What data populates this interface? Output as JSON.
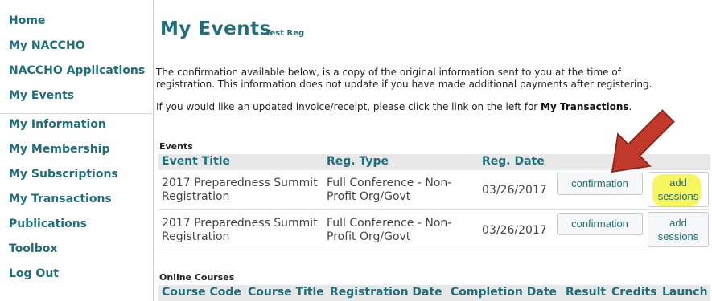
{
  "sidebar": {
    "items": [
      {
        "label": "Home"
      },
      {
        "label": "My NACCHO"
      },
      {
        "label": "NACCHO Applications"
      },
      {
        "label": "My Events"
      },
      {
        "label": "My Information"
      },
      {
        "label": "My Membership"
      },
      {
        "label": "My Subscriptions"
      },
      {
        "label": "My Transactions"
      },
      {
        "label": "Publications"
      },
      {
        "label": "Toolbox"
      },
      {
        "label": "Log Out"
      }
    ]
  },
  "main": {
    "title": "My Events",
    "subtitle": "Test Reg",
    "notice_line1": "The confirmation available below, is a copy of the original information sent to you at the time of",
    "notice_line2": "registration. This information does not update if you have made additional payments after registering.",
    "notice_prefix": "If you would like an updated invoice/receipt, please click the link on the left for ",
    "notice_link": "My Transactions",
    "notice_suffix": "."
  },
  "events": {
    "section_label": "Events",
    "columns": [
      "Event Title",
      "Reg. Type",
      "Reg. Date"
    ],
    "rows": [
      {
        "title_line1": "2017 Preparedness Summit",
        "title_line2": "Registration",
        "type_line1": "Full Conference - Non-",
        "type_line2": "Profit Org/Govt",
        "date": "03/26/2017",
        "confirm_label": "confirmation",
        "add_line1": "add",
        "add_line2": "sessions"
      },
      {
        "title_line1": "2017 Preparedness Summit",
        "title_line2": "Registration",
        "type_line1": "Full Conference - Non-",
        "type_line2": "Profit Org/Govt",
        "date": "03/26/2017",
        "confirm_label": "confirmation",
        "add_line1": "add",
        "add_line2": "sessions"
      }
    ]
  },
  "courses": {
    "section_label": "Online Courses",
    "columns": [
      "Course Code",
      "Course Title",
      "Registration Date",
      "Completion Date",
      "Result",
      "Credits",
      "Launch"
    ]
  },
  "colors": {
    "accent": "#1f6e7a",
    "highlight": "#f7f560",
    "arrow": "#c0392b"
  }
}
